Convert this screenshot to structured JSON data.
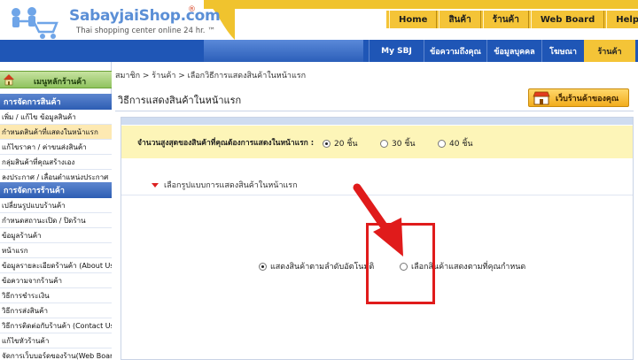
{
  "brand": {
    "name": "SabayjaiShop.com",
    "registered": "®",
    "tagline": "Thai shopping center online 24 hr. ™"
  },
  "top_nav": [
    {
      "label": "Home"
    },
    {
      "label": "สินค้า"
    },
    {
      "label": "ร้านค้า"
    },
    {
      "label": "Web Board"
    },
    {
      "label": "Help"
    }
  ],
  "sub_nav": [
    {
      "label": "My SBJ",
      "active": false
    },
    {
      "label": "ข้อความถึงคุณ",
      "active": false
    },
    {
      "label": "ข้อมูลบุคคล",
      "active": false
    },
    {
      "label": "โฆษณา",
      "active": false
    },
    {
      "label": "ร้านค้า",
      "active": true
    }
  ],
  "sidebar": {
    "home_label": "เมนูหลักร้านค้า",
    "groups": [
      {
        "title": "การจัดการสินค้า",
        "items": [
          {
            "label": "เพิ่ม / แก้ไข ข้อมูลสินค้า",
            "active": false
          },
          {
            "label": "กำหนดสินค้าที่แสดงในหน้าแรก",
            "active": true
          },
          {
            "label": "แก้ไขราคา / ค่าขนส่งสินค้า",
            "active": false
          },
          {
            "label": "กลุ่มสินค้าที่คุณสร้างเอง",
            "active": false
          },
          {
            "label": "ลงประกาศ / เลื่อนตำแหน่งประกาศ",
            "active": false
          }
        ]
      },
      {
        "title": "การจัดการร้านค้า",
        "items": [
          {
            "label": "เปลี่ยนรูปแบบร้านค้า",
            "active": false
          },
          {
            "label": "กำหนดสถานะเปิด / ปิดร้าน",
            "active": false
          },
          {
            "label": "ข้อมูลร้านค้า",
            "active": false
          },
          {
            "label": "หน้าแรก",
            "active": false
          },
          {
            "label": "ข้อมูลรายละเอียดร้านค้า (About Us)",
            "active": false
          },
          {
            "label": "ข้อความจากร้านค้า",
            "active": false
          },
          {
            "label": "วิธีการชำระเงิน",
            "active": false
          },
          {
            "label": "วิธีการส่งสินค้า",
            "active": false
          },
          {
            "label": "วิธีการติดต่อกับร้านค้า (Contact Us)",
            "active": false
          },
          {
            "label": "แก้ไขหัวร้านค้า",
            "active": false
          },
          {
            "label": "จัดการเว็บบอร์ดของร้าน(Web Board)",
            "active": false
          }
        ]
      }
    ]
  },
  "breadcrumb": "สมาชิก > ร้านค้า > เลือกวิธีการแสดงสินค้าในหน้าแรก",
  "page_title": "วิธีการแสดงสินค้าในหน้าแรก",
  "shop_button_label": "เว็บร้านค้าของคุณ",
  "quantity": {
    "label": "จำนวนสูงสุดของสินค้าที่คุณต้องการแสดงในหน้าแรก :",
    "options": [
      {
        "label": "20 ชิ้น",
        "selected": true
      },
      {
        "label": "30 ชิ้น",
        "selected": false
      },
      {
        "label": "40 ชิ้น",
        "selected": false
      }
    ]
  },
  "display_section": {
    "link_label": "เลือกรูปแบบการแสดงสินค้าในหน้าแรก",
    "options": [
      {
        "label": "แสดงสินค้าตามลำดับอัตโนมัติ",
        "selected": true
      },
      {
        "label": "เลือกสินค้าแสดงตามที่คุณกำหนด",
        "selected": false
      }
    ]
  },
  "colors": {
    "brand_blue": "#1f56b6",
    "nav_yellow": "#f4c437",
    "annotation_red": "#e01b1b"
  }
}
